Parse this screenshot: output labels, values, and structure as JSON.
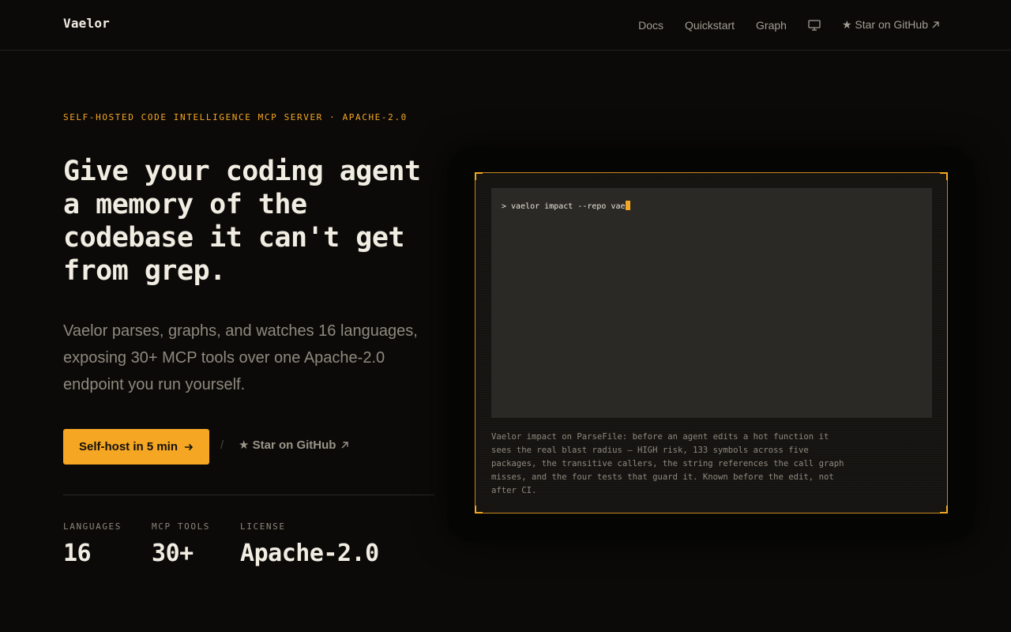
{
  "nav": {
    "brand": "Vaelor",
    "links": [
      "Docs",
      "Quickstart",
      "Graph"
    ],
    "github_label": "★ Star on GitHub",
    "icons": [
      "monitor-icon",
      "arrow-up-right-icon"
    ]
  },
  "hero": {
    "eyebrow": "SELF-HOSTED CODE INTELLIGENCE MCP SERVER · APACHE-2.0",
    "headline": "Give your coding agent a memory of the codebase it can't get from grep.",
    "lede": "Vaelor parses, graphs, and watches 16 languages, exposing 30+ MCP tools over one Apache-2.0 endpoint you run yourself.",
    "cta_label": "Self-host in 5 min",
    "separator": "/",
    "star_label": "★ Star on GitHub"
  },
  "stats": [
    {
      "label": "LANGUAGES",
      "value": "16"
    },
    {
      "label": "MCP TOOLS",
      "value": "30+"
    },
    {
      "label": "LICENSE",
      "value": "Apache-2.0"
    }
  ],
  "terminal": {
    "prompt": "> vaelor impact --repo vae",
    "caption": "Vaelor impact on ParseFile: before an agent edits a hot function it sees the real blast radius — HIGH risk, 133 symbols across five packages, the transitive callers, the string references the call graph misses, and the four tests that guard it. Known before the edit, not after CI."
  },
  "colors": {
    "accent": "#f5a623",
    "background": "#0b0a08",
    "text": "#f2ede3",
    "muted": "#8f897e"
  }
}
